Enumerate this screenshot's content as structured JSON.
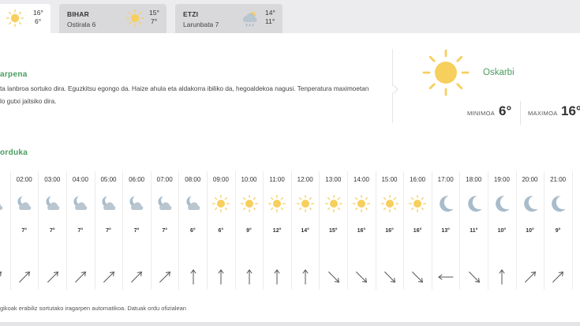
{
  "tabs": [
    {
      "name": "",
      "date": "",
      "max": "16°",
      "min": "6°",
      "icon": "sun-icon",
      "active": true
    },
    {
      "name": "BIHAR",
      "date": "Ostirala 6",
      "max": "15°",
      "min": "7°",
      "icon": "sun-icon",
      "active": false
    },
    {
      "name": "ETZI",
      "date": "Larunbata 7",
      "max": "14°",
      "min": "11°",
      "icon": "cloud-rain-icon",
      "active": false
    }
  ],
  "forecast": {
    "title": "arpena",
    "description_line1": "ta lanbroa sortuko dira. Eguzkitsu egongo da. Haize ahula eta aldakorra ibiliko da, hegoaldekoa nagusi. Tenperatura maximoetan",
    "description_line2": "lo gutxi jaitsiko dira.",
    "condition": "Oskarbi",
    "min_label": "MINIMOA",
    "min_value": "6°",
    "max_label": "MAXIMOA",
    "max_value": "16°"
  },
  "hourly": {
    "title": "orduka",
    "items": [
      {
        "hour": "0",
        "icon": "moon-cloud-icon",
        "temp": "",
        "wind": "up-right"
      },
      {
        "hour": "02:00",
        "icon": "moon-cloud-icon",
        "temp": "7°",
        "wind": "up-right"
      },
      {
        "hour": "03:00",
        "icon": "moon-cloud-icon",
        "temp": "7°",
        "wind": "up-right"
      },
      {
        "hour": "04:00",
        "icon": "moon-cloud-icon",
        "temp": "7°",
        "wind": "up-right"
      },
      {
        "hour": "05:00",
        "icon": "moon-cloud-icon",
        "temp": "7°",
        "wind": "up-right"
      },
      {
        "hour": "06:00",
        "icon": "moon-cloud-icon",
        "temp": "7°",
        "wind": "up-right"
      },
      {
        "hour": "07:00",
        "icon": "moon-cloud-icon",
        "temp": "7°",
        "wind": "up-right"
      },
      {
        "hour": "08:00",
        "icon": "moon-cloud-icon",
        "temp": "6°",
        "wind": "up"
      },
      {
        "hour": "09:00",
        "icon": "sun-icon",
        "temp": "6°",
        "wind": "up"
      },
      {
        "hour": "10:00",
        "icon": "sun-icon",
        "temp": "9°",
        "wind": "up"
      },
      {
        "hour": "11:00",
        "icon": "sun-icon",
        "temp": "12°",
        "wind": "up"
      },
      {
        "hour": "12:00",
        "icon": "sun-icon",
        "temp": "14°",
        "wind": "up"
      },
      {
        "hour": "13:00",
        "icon": "sun-icon",
        "temp": "15°",
        "wind": "down-right"
      },
      {
        "hour": "14:00",
        "icon": "sun-icon",
        "temp": "16°",
        "wind": "down-right"
      },
      {
        "hour": "15:00",
        "icon": "sun-icon",
        "temp": "16°",
        "wind": "down-right"
      },
      {
        "hour": "16:00",
        "icon": "sun-icon",
        "temp": "16°",
        "wind": "down-right"
      },
      {
        "hour": "17:00",
        "icon": "moon-icon",
        "temp": "13°",
        "wind": "left"
      },
      {
        "hour": "18:00",
        "icon": "moon-icon",
        "temp": "11°",
        "wind": "down-right"
      },
      {
        "hour": "19:00",
        "icon": "moon-icon",
        "temp": "10°",
        "wind": "up"
      },
      {
        "hour": "20:00",
        "icon": "moon-icon",
        "temp": "10°",
        "wind": "up-right"
      },
      {
        "hour": "21:00",
        "icon": "moon-icon",
        "temp": "9°",
        "wind": "up-right"
      },
      {
        "hour": "2",
        "icon": "moon-icon",
        "temp": "",
        "wind": "up-right"
      }
    ]
  },
  "footer": {
    "note": "gikoak erabiliz sortutako iragarpen automatikoa. Datuak ordu ofizialean"
  },
  "colors": {
    "accent": "#4a9d5f",
    "sun": "#f7cf5c",
    "moon": "#a9bccb",
    "cloud": "#b9c5cf"
  }
}
